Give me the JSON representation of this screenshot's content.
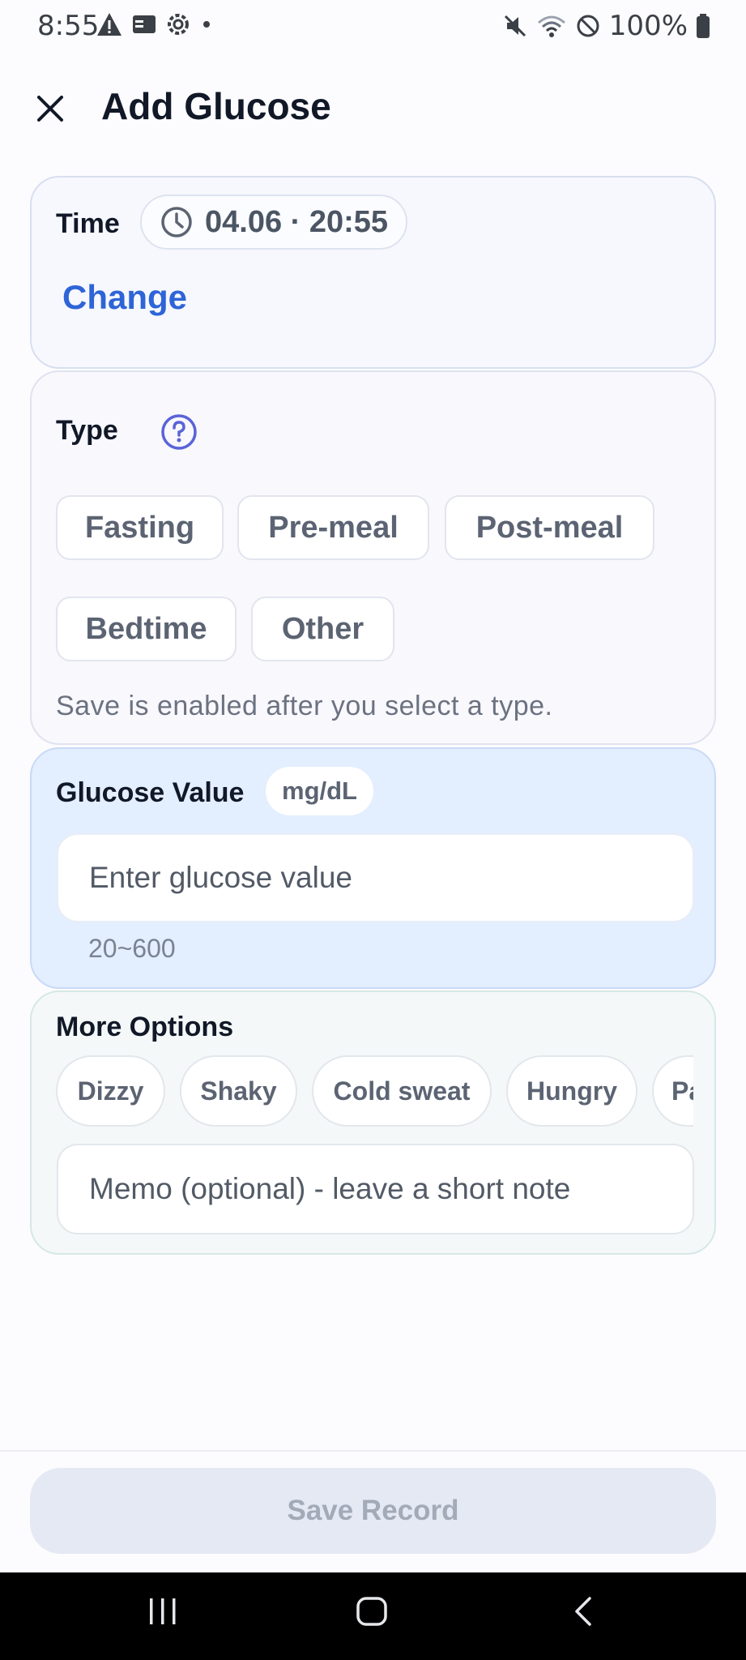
{
  "status_bar": {
    "time": "8:55",
    "battery": "100%"
  },
  "header": {
    "title": "Add Glucose"
  },
  "time_section": {
    "label": "Time",
    "value": "04.06 · 20:55",
    "change_label": "Change"
  },
  "type_section": {
    "label": "Type",
    "options": [
      "Fasting",
      "Pre-meal",
      "Post-meal",
      "Bedtime",
      "Other"
    ],
    "hint": "Save is enabled after you select a type."
  },
  "glucose_section": {
    "label": "Glucose Value",
    "unit": "mg/dL",
    "placeholder": "Enter glucose value",
    "range": "20~600"
  },
  "more_options": {
    "label": "More Options",
    "chips": [
      "Dizzy",
      "Shaky",
      "Cold sweat",
      "Hungry",
      "Pa"
    ],
    "memo_placeholder": "Memo (optional) - leave a short note"
  },
  "footer": {
    "save_label": "Save Record"
  },
  "colors": {
    "accent": "#2f64d7",
    "help_icon": "#5b63d8",
    "glucose_card_bg": "#e3eefe",
    "save_disabled_bg": "#e5e9f3"
  }
}
